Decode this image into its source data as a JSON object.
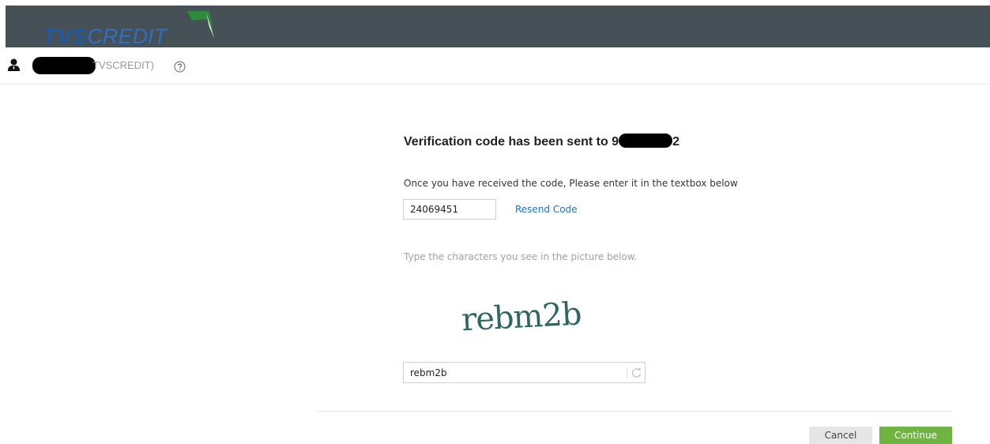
{
  "header": {
    "brand_bold": "TVS",
    "brand_light": "CREDIT",
    "colors": {
      "bar": "#465157",
      "brand": "#1d5aa8",
      "flag": "#2e8b3c"
    }
  },
  "user": {
    "name_suffix": "TVSCREDIT)",
    "icons": {
      "user": "user-icon",
      "help": "help-circle-icon"
    }
  },
  "verify": {
    "title_prefix": "Verification code has been sent to 9",
    "title_suffix": "2",
    "instruction": "Once you have received the code, Please enter it in the textbox below",
    "code_value": "24069451",
    "resend_label": "Resend Code"
  },
  "captcha": {
    "hint": "Type the characters you see in the picture below.",
    "image_text": "rebm2b",
    "input_value": "rebm2b",
    "refresh_icon": "refresh-icon"
  },
  "actions": {
    "cancel_label": "Cancel",
    "continue_label": "Continue",
    "colors": {
      "continue": "#6fb443",
      "link": "#1f73b7"
    }
  }
}
